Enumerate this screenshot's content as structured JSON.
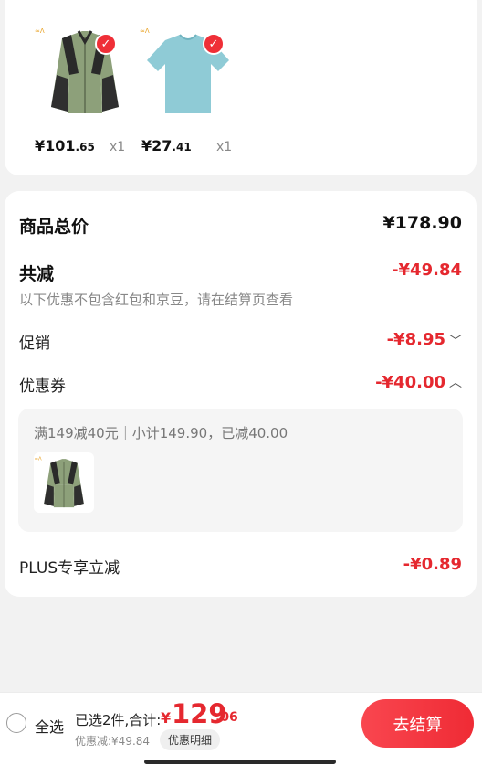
{
  "items": [
    {
      "price_int": "¥101",
      "price_dec": ".65",
      "qty": "x1",
      "image": "green-jacket",
      "checked": true
    },
    {
      "price_int": "¥27",
      "price_dec": ".41",
      "qty": "x1",
      "image": "blue-tshirt",
      "checked": true
    }
  ],
  "summary": {
    "total_label": "商品总价",
    "total_value": "¥178.90",
    "discount_label": "共减",
    "discount_value": "-¥49.84",
    "discount_note": "以下优惠不包含红包和京豆，请在结算页查看",
    "promo_label": "促销",
    "promo_value": "-¥8.95",
    "coupon_label": "优惠券",
    "coupon_value": "-¥40.00",
    "coupon_detail": "满149减40元｜小计149.90，已减40.00",
    "plus_label": "PLUS专享立减",
    "plus_value": "-¥0.89"
  },
  "bottom": {
    "select_all": "全选",
    "selected_text": "已选2件,合计:",
    "total_symbol": "¥",
    "total_int": "129",
    "total_dec": ".06",
    "discount_text": "优惠减:¥49.84",
    "detail_button": "优惠明细",
    "checkout_button": "去结算"
  },
  "colors": {
    "accent": "#e5282f",
    "button": "#f43d46"
  },
  "icons": {
    "check": "checkmark-icon",
    "expand": "chevron-down-icon",
    "collapse": "chevron-up-icon"
  }
}
